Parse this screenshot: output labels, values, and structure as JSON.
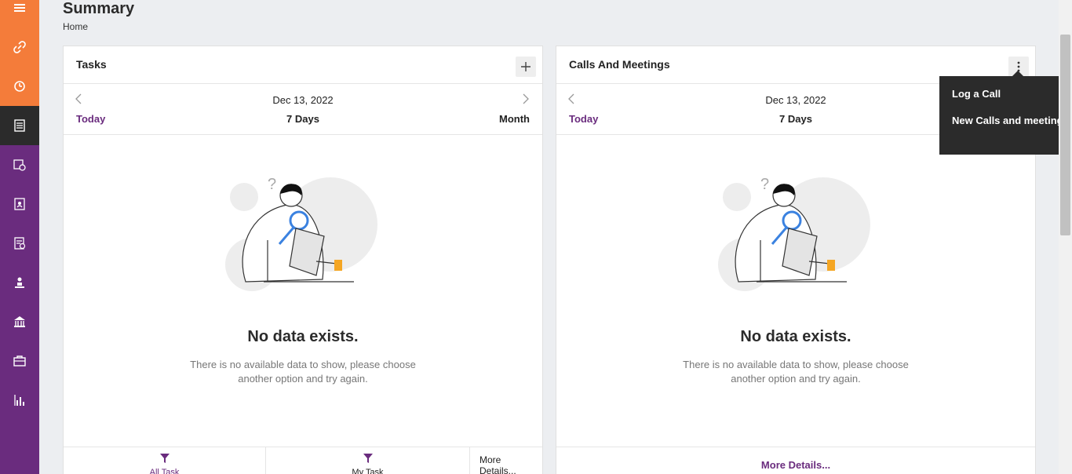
{
  "page": {
    "title": "Summary",
    "breadcrumb": "Home"
  },
  "sidebar": {
    "items": [
      {
        "icon": "menu-icon"
      },
      {
        "icon": "link-icon"
      },
      {
        "icon": "timer-icon"
      },
      {
        "icon": "document-list-icon"
      },
      {
        "icon": "calendar-clock-icon"
      },
      {
        "icon": "contact-book-icon"
      },
      {
        "icon": "report-clock-icon"
      },
      {
        "icon": "person-icon"
      },
      {
        "icon": "bank-icon"
      },
      {
        "icon": "briefcase-icon"
      },
      {
        "icon": "bar-chart-icon"
      }
    ],
    "colors": {
      "purple": "#6a2c7e",
      "orange": "#f47c3a",
      "active": "#2b2b2b"
    }
  },
  "tasks": {
    "title": "Tasks",
    "date": "Dec 13, 2022",
    "views": {
      "today": "Today",
      "seven": "7 Days",
      "month": "Month"
    },
    "empty_title": "No data exists.",
    "empty_desc": "There is no available data to show, please choose another option and try again.",
    "footer": {
      "all": "All Task",
      "my": "My Task",
      "more": "More Details..."
    }
  },
  "calls": {
    "title": "Calls And Meetings",
    "date": "Dec 13, 2022",
    "views": {
      "today": "Today",
      "seven": "7 Days"
    },
    "empty_title": "No data exists.",
    "empty_desc": "There is no available data to show, please choose another option and try again.",
    "footer": {
      "more": "More Details..."
    }
  },
  "menu": {
    "items": [
      "Log a Call",
      "New Calls and meeting"
    ]
  }
}
